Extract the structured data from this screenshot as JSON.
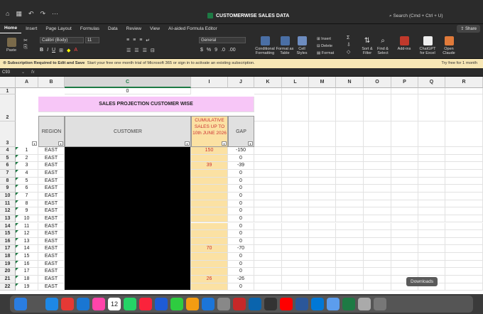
{
  "window": {
    "title": "CUSTOMERWISE SALES DATA",
    "search_placeholder": "Search (Cmd + Ctrl + U)"
  },
  "menu": [
    "Home",
    "Insert",
    "Page Layout",
    "Formulas",
    "Data",
    "Review",
    "View",
    "AI-aided Formula Editor"
  ],
  "share_label": "Share",
  "ribbon": {
    "paste": "Paste",
    "font_name": "Calibri (Body)",
    "font_size": "11",
    "number_format": "General",
    "insert": "Insert",
    "delete": "Delete",
    "format": "Format",
    "conditional_formatting": "Conditional Formatting",
    "format_as_table": "Format as Table",
    "cell_styles": "Cell Styles",
    "sort_filter": "Sort & Filter",
    "find_select": "Find & Select",
    "add_ins": "Add-ins",
    "chatgpt": "ChatGPT for Excel",
    "open_claude": "Open Claude"
  },
  "notice": {
    "bold": "Subscription Required to Edit and Save",
    "text": "Start your free one month trial of Microsoft 365 or sign in to activate an existing subscription.",
    "try_label": "Try free for 1 month"
  },
  "formula_bar": {
    "name_box": "C93",
    "fx": "fx"
  },
  "columns": [
    "A",
    "B",
    "C",
    "I",
    "J",
    "K",
    "L",
    "M",
    "N",
    "O",
    "P",
    "Q",
    "R"
  ],
  "sheet": {
    "c1_value": "0",
    "title": "SALES PROJECTION CUSTOMER WISE",
    "headers": {
      "region": "REGION",
      "customer": "CUSTOMER",
      "cumulative": "CUMULATIVE SALES UP TO 10th JUNE 2026",
      "gap": "GAP"
    },
    "rows": [
      {
        "row": "4",
        "a": "1",
        "b": "EAST",
        "i": "150",
        "j": "-150"
      },
      {
        "row": "5",
        "a": "2",
        "b": "EAST",
        "i": "",
        "j": "0"
      },
      {
        "row": "6",
        "a": "3",
        "b": "EAST",
        "i": "39",
        "j": "-39"
      },
      {
        "row": "7",
        "a": "4",
        "b": "EAST",
        "i": "",
        "j": "0"
      },
      {
        "row": "8",
        "a": "5",
        "b": "EAST",
        "i": "",
        "j": "0"
      },
      {
        "row": "9",
        "a": "6",
        "b": "EAST",
        "i": "",
        "j": "0"
      },
      {
        "row": "10",
        "a": "7",
        "b": "EAST",
        "i": "",
        "j": "0"
      },
      {
        "row": "11",
        "a": "8",
        "b": "EAST",
        "i": "",
        "j": "0"
      },
      {
        "row": "12",
        "a": "9",
        "b": "EAST",
        "i": "",
        "j": "0"
      },
      {
        "row": "13",
        "a": "10",
        "b": "EAST",
        "i": "",
        "j": "0"
      },
      {
        "row": "14",
        "a": "11",
        "b": "EAST",
        "i": "",
        "j": "0"
      },
      {
        "row": "15",
        "a": "12",
        "b": "EAST",
        "i": "",
        "j": "0"
      },
      {
        "row": "16",
        "a": "13",
        "b": "EAST",
        "i": "",
        "j": "0"
      },
      {
        "row": "17",
        "a": "14",
        "b": "EAST",
        "i": "70",
        "j": "-70"
      },
      {
        "row": "18",
        "a": "15",
        "b": "EAST",
        "i": "",
        "j": "0"
      },
      {
        "row": "19",
        "a": "16",
        "b": "EAST",
        "i": "",
        "j": "0"
      },
      {
        "row": "20",
        "a": "17",
        "b": "EAST",
        "i": "",
        "j": "0"
      },
      {
        "row": "21",
        "a": "18",
        "b": "EAST",
        "i": "26",
        "j": "-26"
      },
      {
        "row": "22",
        "a": "19",
        "b": "EAST",
        "i": "",
        "j": "0"
      }
    ]
  },
  "dock": {
    "tooltip": "Downloads",
    "calendar_day": "12",
    "apps": [
      "finder-icon",
      "launchpad-icon",
      "safari-icon",
      "chrome-icon",
      "appstore-icon",
      "photos-icon",
      "calendar-icon",
      "whatsapp-icon",
      "music-icon",
      "keynote-icon",
      "numbers-icon",
      "pages-icon",
      "xcode-icon",
      "settings-icon",
      "pdf-icon",
      "outlook-icon",
      "stocks-icon",
      "youtube-icon",
      "word-icon",
      "edge-icon",
      "preview-icon",
      "excel-icon",
      "downloads-icon",
      "trash-icon"
    ]
  }
}
